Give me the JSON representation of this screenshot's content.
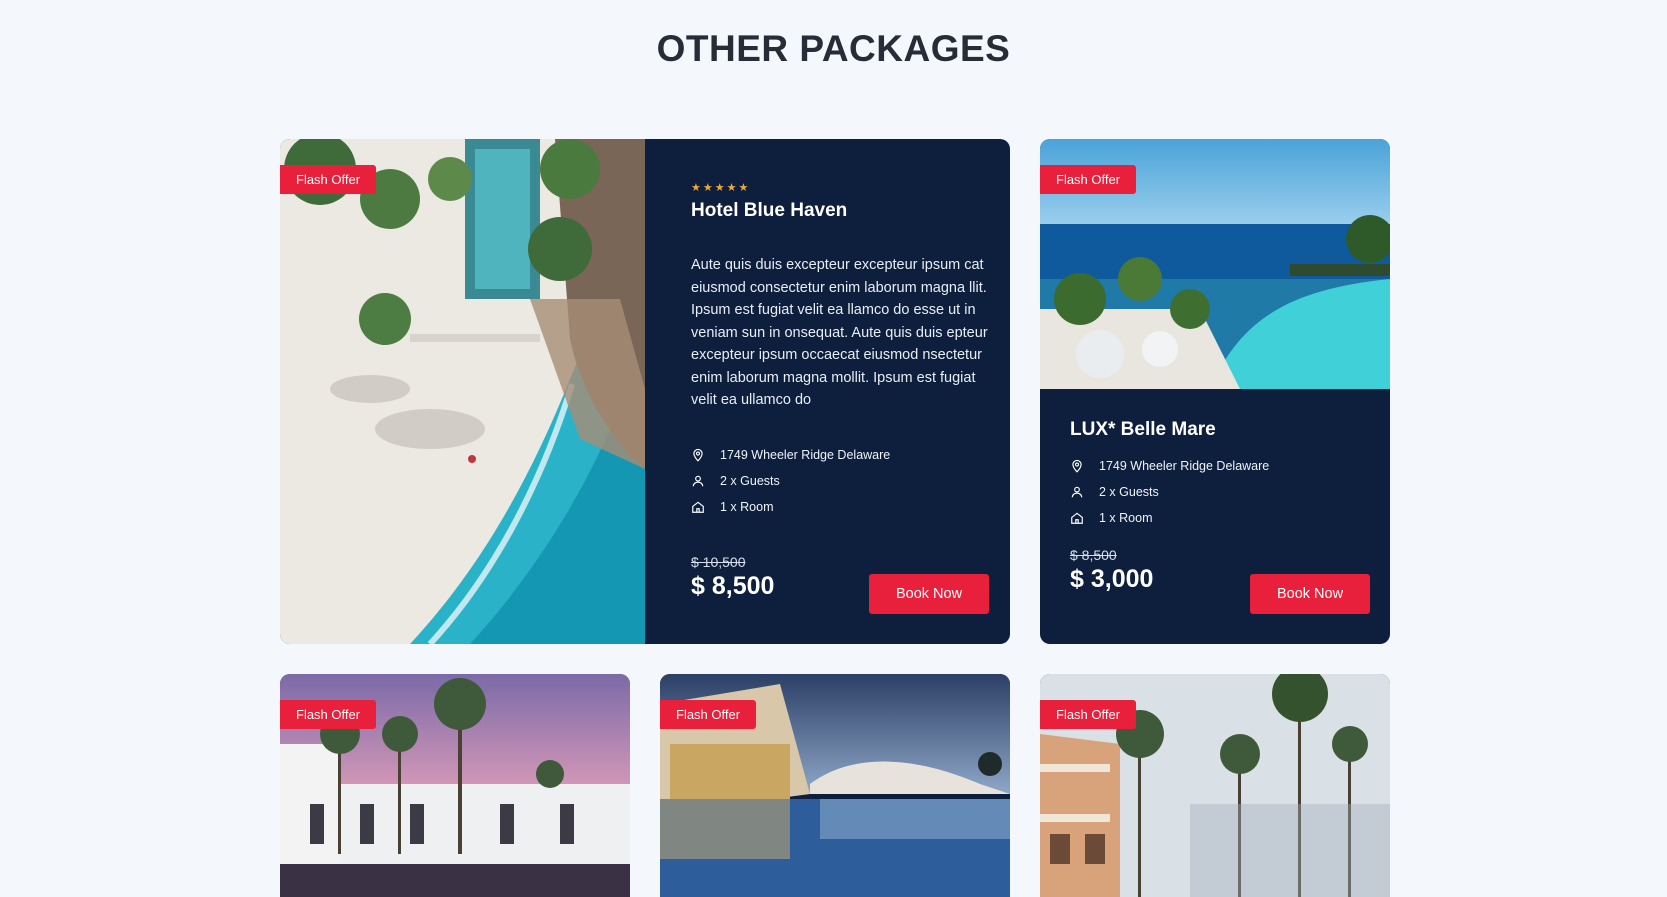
{
  "section": {
    "title": "OTHER PACKAGES"
  },
  "badge": "Flash Offer",
  "featured": {
    "stars": "★★★★★",
    "name": "Hotel Blue Haven",
    "description": "Aute quis duis excepteur excepteur ipsum cat eiusmod consectetur enim laborum magna llit. Ipsum est fugiat velit ea llamco do esse ut in veniam sun in onsequat. Aute quis duis epteur excepteur ipsum occaecat eiusmod nsectetur enim laborum magna mollit. Ipsum est fugiat velit ea ullamco do",
    "location": "1749 Wheeler Ridge Delaware",
    "guests": "2 x Guests",
    "rooms": "1 x Room",
    "old_price": "$ 10,500",
    "price": "$ 8,500",
    "button": "Book Now"
  },
  "second": {
    "name": "LUX* Belle Mare",
    "location": "1749 Wheeler Ridge Delaware",
    "guests": "2 x Guests",
    "rooms": "1 x Room",
    "old_price": "$ 8,500",
    "price": "$ 3,000",
    "button": "Book Now"
  },
  "icons": {
    "location": "location-pin-icon",
    "guests": "person-icon",
    "rooms": "home-icon",
    "rating": "star-icon"
  },
  "colors": {
    "accent": "#e8203c",
    "card_bg": "#0d1f3d",
    "page_bg": "#f4f8fc",
    "star": "#f0a63a"
  }
}
